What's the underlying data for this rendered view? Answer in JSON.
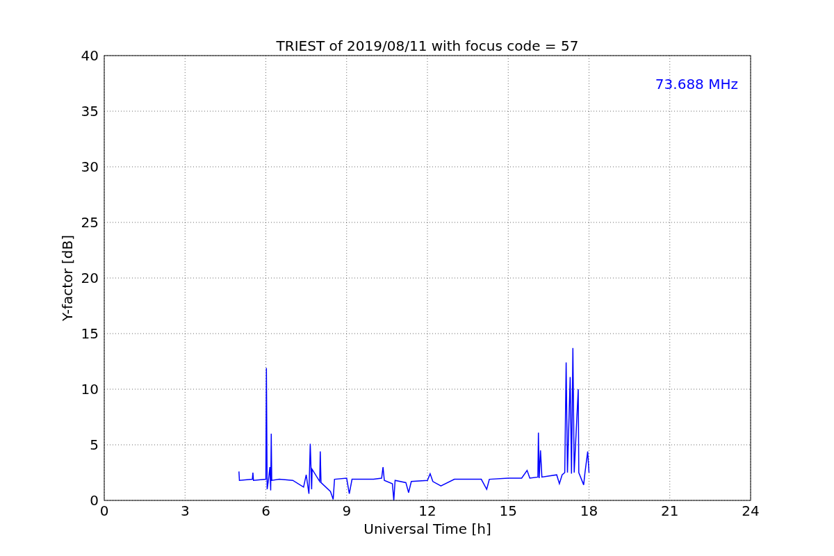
{
  "chart_data": {
    "type": "line",
    "title": "TRIEST of 2019/08/11 with focus code = 57",
    "xlabel": "Universal Time [h]",
    "ylabel": "Y-factor [dB]",
    "x": [
      5.0,
      5.02,
      5.5,
      5.52,
      5.54,
      6.0,
      6.02,
      6.05,
      6.1,
      6.15,
      6.18,
      6.2,
      6.22,
      6.5,
      7.0,
      7.4,
      7.5,
      7.6,
      7.65,
      7.7,
      7.72,
      8.0,
      8.02,
      8.05,
      8.4,
      8.5,
      8.55,
      9.0,
      9.1,
      9.2,
      10.0,
      10.3,
      10.35,
      10.4,
      10.7,
      10.75,
      10.8,
      11.2,
      11.3,
      11.4,
      12.0,
      12.1,
      12.2,
      12.5,
      13.0,
      14.0,
      14.2,
      14.3,
      15.0,
      15.5,
      15.7,
      15.8,
      16.1,
      16.12,
      16.15,
      16.2,
      16.25,
      16.8,
      16.9,
      17.0,
      17.1,
      17.15,
      17.2,
      17.3,
      17.35,
      17.4,
      17.45,
      17.6,
      17.62,
      17.8,
      17.85,
      17.95,
      18.0
    ],
    "series": [
      {
        "name": "73.688 MHz",
        "color": "#0000ff",
        "values": [
          2.6,
          1.8,
          1.9,
          2.5,
          1.8,
          1.9,
          11.9,
          1.0,
          1.9,
          3.0,
          0.9,
          6.0,
          1.8,
          1.9,
          1.8,
          1.2,
          2.3,
          0.6,
          5.1,
          1.0,
          2.8,
          1.7,
          4.4,
          1.6,
          0.8,
          0.1,
          1.9,
          2.0,
          0.6,
          1.9,
          1.9,
          2.0,
          3.0,
          1.8,
          1.5,
          0.0,
          1.8,
          1.6,
          0.7,
          1.7,
          1.8,
          2.4,
          1.7,
          1.3,
          1.9,
          1.9,
          1.0,
          1.9,
          2.0,
          2.0,
          2.7,
          2.0,
          2.1,
          6.1,
          2.0,
          4.5,
          2.1,
          2.3,
          1.5,
          2.3,
          2.5,
          12.4,
          2.5,
          11.1,
          2.4,
          13.7,
          2.5,
          10.0,
          2.5,
          1.4,
          2.5,
          4.4,
          2.5
        ]
      }
    ],
    "xlim": [
      0,
      24
    ],
    "ylim": [
      0,
      40
    ],
    "xticks": [
      0,
      3,
      6,
      9,
      12,
      15,
      18,
      21,
      24
    ],
    "yticks": [
      0,
      5,
      10,
      15,
      20,
      25,
      30,
      35,
      40
    ],
    "grid": true
  }
}
